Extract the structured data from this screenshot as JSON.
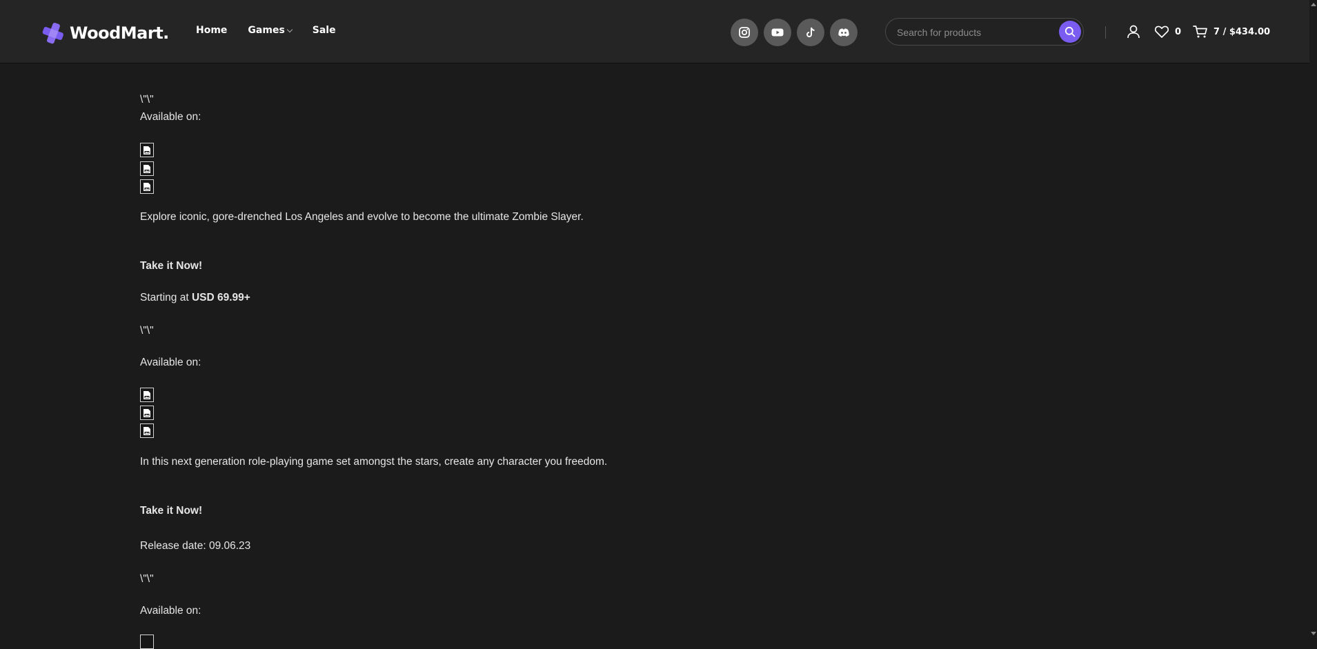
{
  "header": {
    "brand": "WoodMart.",
    "nav": [
      {
        "label": "Home"
      },
      {
        "label": "Games"
      },
      {
        "label": "Sale"
      }
    ],
    "socials": [
      "instagram-icon",
      "youtube-icon",
      "tiktok-icon",
      "discord-icon"
    ],
    "search": {
      "placeholder": "Search for products"
    },
    "wishlist_count": "0",
    "cart_summary": "7 / $434.00",
    "accent_color": "#7b5cf0"
  },
  "content": {
    "block1": {
      "quote": "\\\"\\\"",
      "available_label": "Available on:",
      "description": "Explore iconic, gore-drenched Los Angeles and evolve to become the ultimate Zombie Slayer.",
      "cta": "Take it Now!",
      "price_prefix": "Starting at",
      "price_value": "USD 69.99+"
    },
    "block2": {
      "quote": "\\\"\\\"",
      "available_label": "Available on:",
      "description": "In this next generation role-playing game set amongst the stars, create any character you freedom.",
      "cta": "Take it Now!",
      "release_date": "Release date: 09.06.23"
    },
    "block3": {
      "quote": "\\\"\\\"",
      "available_label": "Available on:"
    }
  }
}
